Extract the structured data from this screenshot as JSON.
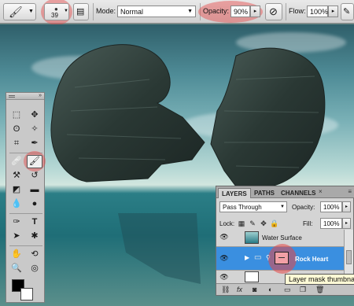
{
  "options_bar": {
    "brush_size": "39",
    "mode_label": "Mode:",
    "mode_value": "Normal",
    "opacity_label": "Opacity:",
    "opacity_value": "90%",
    "flow_label": "Flow:",
    "flow_value": "100%",
    "highlight_color": "#e64646"
  },
  "layers_panel": {
    "tabs": [
      "LAYERS",
      "PATHS",
      "CHANNELS"
    ],
    "blend_mode": "Pass Through",
    "opacity_label": "Opacity:",
    "opacity_value": "100%",
    "lock_label": "Lock:",
    "fill_label": "Fill:",
    "fill_value": "100%",
    "layers": [
      {
        "name": "Water Surface",
        "visible": true,
        "selected": false
      },
      {
        "name": "Rock Heart",
        "visible": true,
        "selected": true
      }
    ],
    "selected_color": "#3a8fe0",
    "tooltip": "Layer mask thumbna"
  },
  "icons": {
    "brush": "brush-icon",
    "airbrush": "airbrush-icon",
    "eye": "eye-icon",
    "folder": "folder-icon"
  }
}
